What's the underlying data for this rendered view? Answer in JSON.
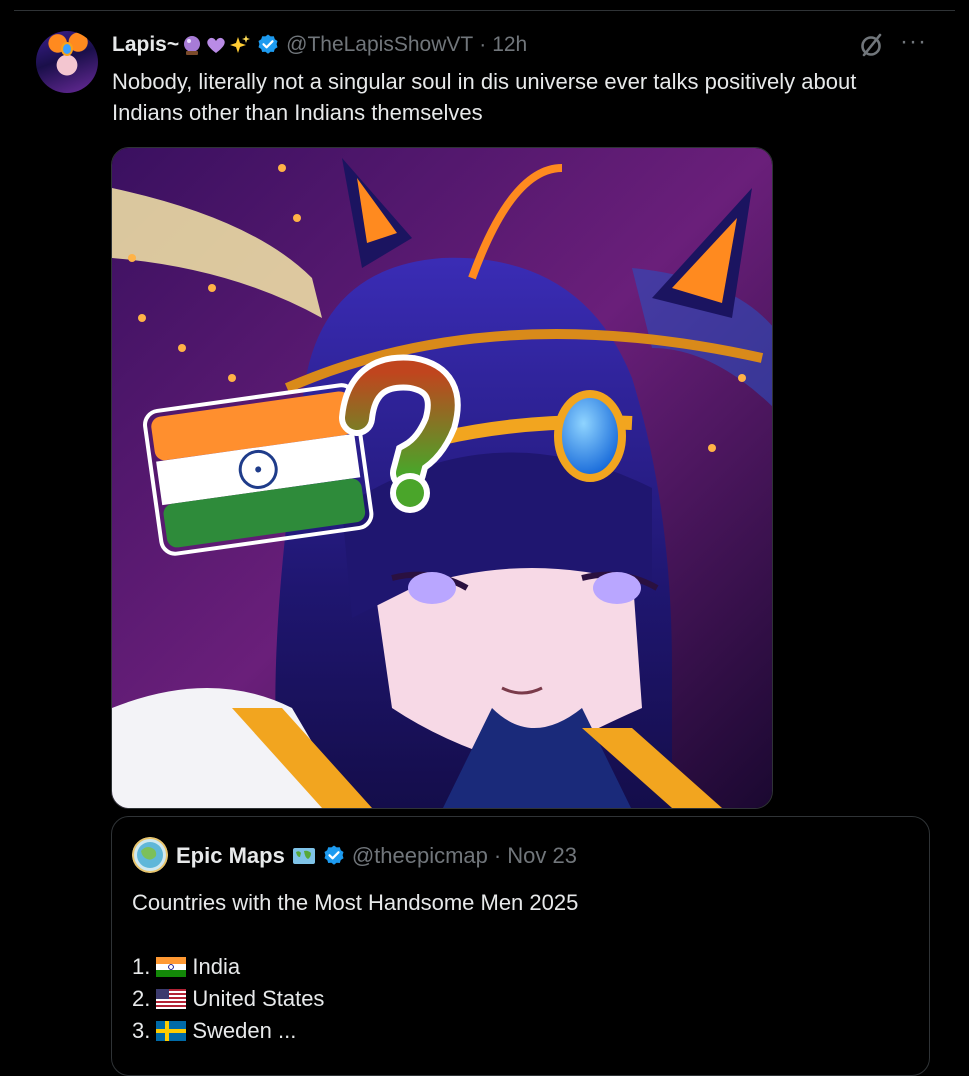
{
  "post": {
    "display_name": "Lapis~",
    "name_emojis": [
      "crystal-ball-icon",
      "purple-heart-icon",
      "sparkles-icon"
    ],
    "handle": "@TheLapisShowVT",
    "separator": "·",
    "time": "12h",
    "text": "Nobody, literally not a singular soul in dis universe ever talks positively about Indians other than Indians themselves",
    "more_label": "···",
    "icons": {
      "grok": "grok-icon",
      "more": "more-icon",
      "verified": "verified-badge-icon"
    },
    "colors": {
      "background": "#000000",
      "verified": "#1d9bf0",
      "muted": "#71767b",
      "text": "#e7e9ea"
    }
  },
  "quote": {
    "display_name": "Epic Maps",
    "name_emoji": "world-map-icon",
    "handle": "@theepicmap",
    "separator": "·",
    "date": "Nov 23",
    "title": "Countries with the Most Handsome Men 2025",
    "items": [
      {
        "num": "1.",
        "flag": "india-flag-icon",
        "label": "India",
        "suffix": ""
      },
      {
        "num": "2.",
        "flag": "us-flag-icon",
        "label": "United States",
        "suffix": ""
      },
      {
        "num": "3.",
        "flag": "sweden-flag-icon",
        "label": "Sweden",
        "suffix": " ..."
      }
    ]
  }
}
